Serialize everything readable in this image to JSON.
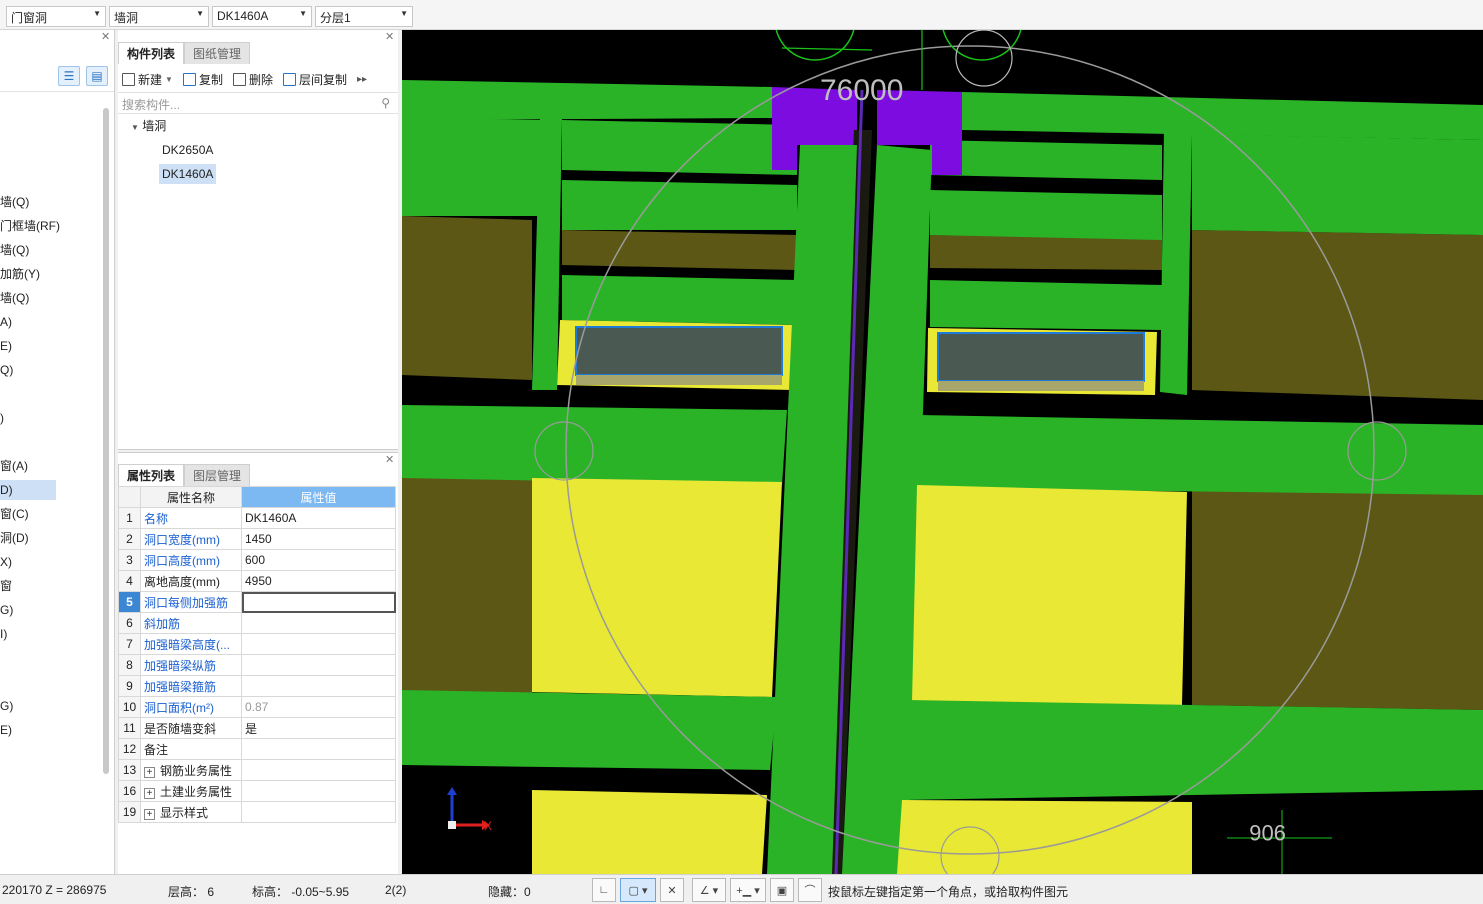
{
  "toolbar": {
    "combos": [
      {
        "value": "门窗洞"
      },
      {
        "value": "墙洞"
      },
      {
        "value": "DK1460A"
      },
      {
        "value": "分层1"
      }
    ]
  },
  "nav": {
    "items": [
      {
        "label": "墙(Q)"
      },
      {
        "label": "门框墙(RF)"
      },
      {
        "label": "墙(Q)"
      },
      {
        "label": "加筋(Y)"
      },
      {
        "label": "墙(Q)"
      },
      {
        "label": "A)"
      },
      {
        "label": "E)"
      },
      {
        "label": "Q)"
      },
      {
        "label": ")"
      },
      {
        "label": "窗(A)"
      },
      {
        "label": "D)"
      },
      {
        "label": "窗(C)"
      },
      {
        "label": "洞(D)"
      },
      {
        "label": "X)"
      },
      {
        "label": "窗"
      },
      {
        "label": "G)"
      },
      {
        "label": "I)"
      },
      {
        "label": "G)"
      },
      {
        "label": "E)"
      }
    ]
  },
  "component_panel": {
    "tabs": [
      "构件列表",
      "图纸管理"
    ],
    "actions": {
      "new": "新建",
      "copy": "复制",
      "delete": "删除",
      "floor_copy": "层间复制"
    },
    "search_placeholder": "搜索构件...",
    "tree": {
      "root": "墙洞",
      "children": [
        "DK2650A",
        "DK1460A"
      ]
    }
  },
  "property_panel": {
    "tabs": [
      "属性列表",
      "图层管理"
    ],
    "header": {
      "name": "属性名称",
      "value": "属性值"
    },
    "rows": [
      {
        "num": "1",
        "name": "名称",
        "value": "DK1460A"
      },
      {
        "num": "2",
        "name": "洞口宽度(mm)",
        "value": "1450"
      },
      {
        "num": "3",
        "name": "洞口高度(mm)",
        "value": "600"
      },
      {
        "num": "4",
        "name": "离地高度(mm)",
        "value": "4950"
      },
      {
        "num": "5",
        "name": "洞口每侧加强筋",
        "value": ""
      },
      {
        "num": "6",
        "name": "斜加筋",
        "value": ""
      },
      {
        "num": "7",
        "name": "加强暗梁高度(...",
        "value": ""
      },
      {
        "num": "8",
        "name": "加强暗梁纵筋",
        "value": ""
      },
      {
        "num": "9",
        "name": "加强暗梁箍筋",
        "value": ""
      },
      {
        "num": "10",
        "name": "洞口面积(m²)",
        "value": "0.87"
      },
      {
        "num": "11",
        "name": "是否随墙变斜",
        "value": "是"
      },
      {
        "num": "12",
        "name": "备注",
        "value": ""
      },
      {
        "num": "13",
        "name": "钢筋业务属性",
        "value": ""
      },
      {
        "num": "16",
        "name": "土建业务属性",
        "value": ""
      },
      {
        "num": "19",
        "name": "显示样式",
        "value": ""
      }
    ]
  },
  "viewport": {
    "dim_top": "76000",
    "dim_bottom": "906",
    "axis_x": "X",
    "colors": {
      "green": "#2ab327",
      "yellow": "#e9e834",
      "olive": "#5c5714",
      "purple": "#7c0ce0",
      "opening": "#4a5a52"
    }
  },
  "status": {
    "coords": "220170 Z = 286975",
    "floor_height": "层高： 6",
    "elevation": "标高： -0.05~5.95",
    "count": "2(2)",
    "hidden": "隐藏：0",
    "hint": "按鼠标左键指定第一个角点，或拾取构件图元"
  }
}
